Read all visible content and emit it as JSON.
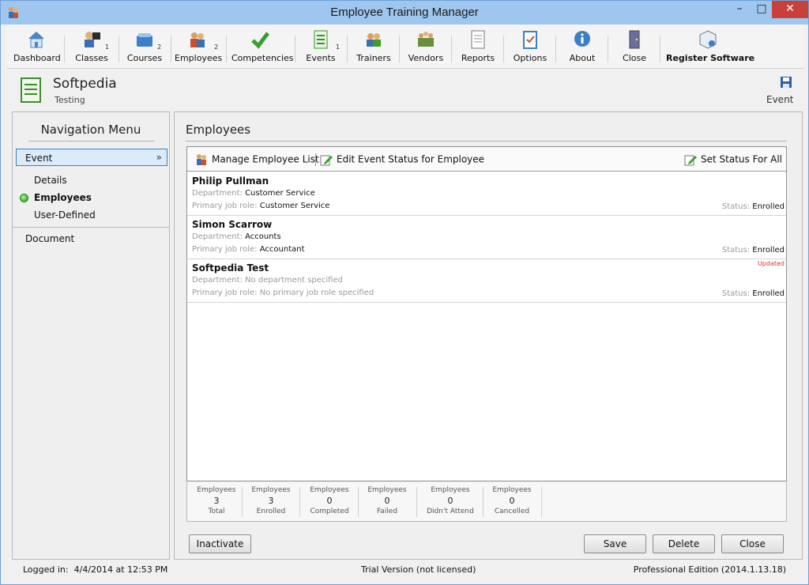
{
  "window": {
    "title": "Employee Training Manager",
    "minimize": "–",
    "maximize": "□",
    "close": "✕"
  },
  "toolbar": {
    "items": [
      {
        "label": "Dashboard",
        "count": ""
      },
      {
        "label": "Classes",
        "count": "1"
      },
      {
        "label": "Courses",
        "count": "2"
      },
      {
        "label": "Employees",
        "count": "2"
      },
      {
        "label": "Competencies",
        "count": ""
      },
      {
        "label": "Events",
        "count": "1"
      },
      {
        "label": "Trainers",
        "count": ""
      },
      {
        "label": "Vendors",
        "count": ""
      },
      {
        "label": "Reports",
        "count": ""
      },
      {
        "label": "Options",
        "count": ""
      },
      {
        "label": "About",
        "count": ""
      },
      {
        "label": "Close",
        "count": ""
      },
      {
        "label": "Register Software",
        "count": ""
      }
    ]
  },
  "header": {
    "name": "Softpedia",
    "subtitle": "Testing",
    "context": "Event"
  },
  "nav": {
    "title": "Navigation Menu",
    "dropdown": "Event",
    "items": [
      "Details",
      "Employees",
      "User-Defined"
    ],
    "document": "Document"
  },
  "main": {
    "title": "Employees",
    "tools": {
      "manage": "Manage Employee List",
      "edit_status": "Edit Event Status for Employee",
      "set_all": "Set Status For All"
    },
    "labels": {
      "department": "Department:",
      "job_role": "Primary job role:",
      "status": "Status:"
    },
    "employees": [
      {
        "name": "Philip Pullman",
        "department": "Customer Service",
        "job_role": "Customer Service",
        "status": "Enrolled",
        "flag": ""
      },
      {
        "name": "Simon Scarrow",
        "department": "Accounts",
        "job_role": "Accountant",
        "status": "Enrolled",
        "flag": ""
      },
      {
        "name": "Softpedia Test",
        "department": "No department specified",
        "job_role": "No primary job role specified",
        "status": "Enrolled",
        "flag": "Updated"
      }
    ],
    "stats": [
      {
        "top": "Employees",
        "value": "3",
        "bottom": "Total"
      },
      {
        "top": "Employees",
        "value": "3",
        "bottom": "Enrolled"
      },
      {
        "top": "Employees",
        "value": "0",
        "bottom": "Completed"
      },
      {
        "top": "Employees",
        "value": "0",
        "bottom": "Failed"
      },
      {
        "top": "Employees",
        "value": "0",
        "bottom": "Didn't Attend"
      },
      {
        "top": "Employees",
        "value": "0",
        "bottom": "Cancelled"
      }
    ]
  },
  "buttons": {
    "inactivate": "Inactivate",
    "save": "Save",
    "delete": "Delete",
    "close": "Close"
  },
  "statusbar": {
    "logged_in_label": "Logged in:",
    "logged_in_value": "4/4/2014 at 12:53 PM",
    "license": "Trial Version (not licensed)",
    "edition": "Professional Edition (2014.1.13.18)"
  },
  "colors": {
    "titlebar": "#9fc6ee",
    "accent": "#3c7fc4",
    "close_button": "#c7403a",
    "status_dot": "#2c9a1f",
    "updated_flag": "#e03030"
  }
}
